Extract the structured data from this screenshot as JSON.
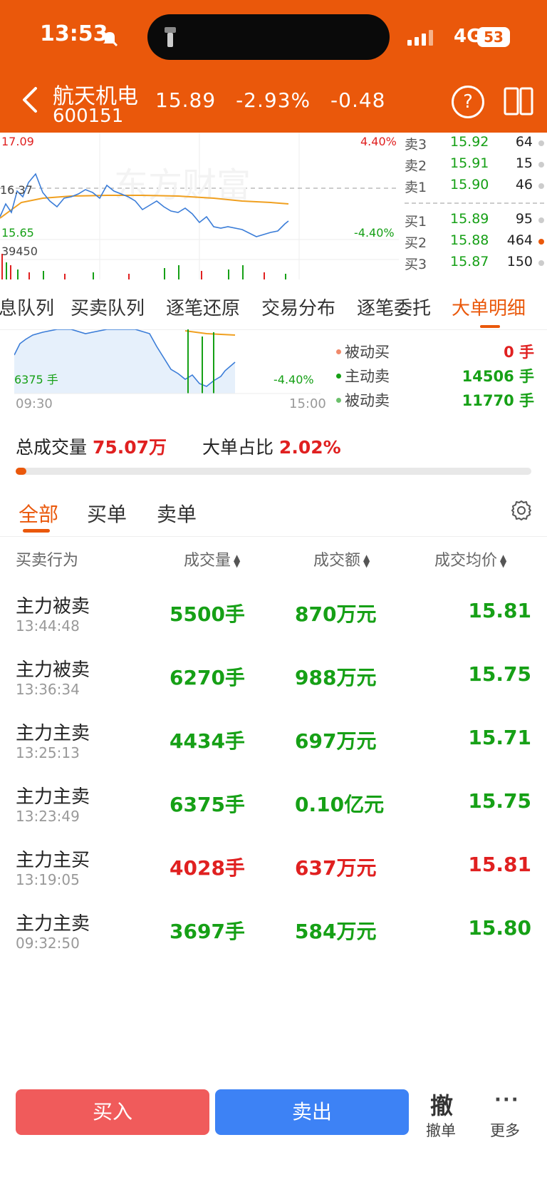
{
  "status_bar": {
    "time": "13:53",
    "network": "4G",
    "battery": "53"
  },
  "header": {
    "stock_name": "航天机电",
    "stock_code": "600151",
    "price": "15.89",
    "change_pct": "-2.93%",
    "change": "-0.48",
    "help": "?"
  },
  "mini_chart": {
    "high": "17.09",
    "high_pct": "4.40%",
    "pre_close": "16.37",
    "low": "15.65",
    "low_pct": "-4.40%",
    "vol": "39450",
    "watermark": "东方财富"
  },
  "order_book": {
    "asks": [
      {
        "label": "卖3",
        "price": "15.92",
        "vol": "64"
      },
      {
        "label": "卖2",
        "price": "15.91",
        "vol": "15"
      },
      {
        "label": "卖1",
        "price": "15.90",
        "vol": "46"
      }
    ],
    "bids": [
      {
        "label": "买1",
        "price": "15.89",
        "vol": "95"
      },
      {
        "label": "买2",
        "price": "15.88",
        "vol": "464"
      },
      {
        "label": "买3",
        "price": "15.87",
        "vol": "150"
      }
    ]
  },
  "tabs": [
    "息队列",
    "买卖队列",
    "逐笔还原",
    "交易分布",
    "逐笔委托",
    "大单明细"
  ],
  "big_chart": {
    "low_label": "6375 手",
    "low_pct": "-4.40%",
    "time_start": "09:30",
    "time_end": "15:00"
  },
  "legend": [
    {
      "label": "被动买",
      "value": "0 手",
      "dot": "#f08a6b",
      "color": "#e02020"
    },
    {
      "label": "主动卖",
      "value": "14506 手",
      "dot": "#16a016",
      "color": "#16a016"
    },
    {
      "label": "被动卖",
      "value": "11770 手",
      "dot": "#6cc06c",
      "color": "#16a016"
    }
  ],
  "summary": {
    "total_label": "总成交量",
    "total_value": "75.07万",
    "ratio_label": "大单占比",
    "ratio_value": "2.02%",
    "ratio_fraction": 0.0202
  },
  "filter_tabs": [
    "全部",
    "买单",
    "卖单"
  ],
  "table": {
    "headers": [
      "买卖行为",
      "成交量",
      "成交额",
      "成交均价"
    ],
    "rows": [
      {
        "action": "主力被卖",
        "time": "13:44:48",
        "volume": "5500手",
        "amount": "870万元",
        "avg": "15.81",
        "side": "sell"
      },
      {
        "action": "主力被卖",
        "time": "13:36:34",
        "volume": "6270手",
        "amount": "988万元",
        "avg": "15.75",
        "side": "sell"
      },
      {
        "action": "主力主卖",
        "time": "13:25:13",
        "volume": "4434手",
        "amount": "697万元",
        "avg": "15.71",
        "side": "sell"
      },
      {
        "action": "主力主卖",
        "time": "13:23:49",
        "volume": "6375手",
        "amount": "0.10亿元",
        "avg": "15.75",
        "side": "sell"
      },
      {
        "action": "主力主买",
        "time": "13:19:05",
        "volume": "4028手",
        "amount": "637万元",
        "avg": "15.81",
        "side": "buy"
      },
      {
        "action": "主力主卖",
        "time": "09:32:50",
        "volume": "3697手",
        "amount": "584万元",
        "avg": "15.80",
        "side": "sell"
      }
    ]
  },
  "bottom_bar": {
    "buy": "买入",
    "sell": "卖出",
    "cancel_icon": "撤",
    "cancel": "撤单",
    "more_icon": "···",
    "more": "更多"
  },
  "colors": {
    "accent": "#ea580b",
    "up": "#e02020",
    "down": "#16a016",
    "sell_button": "#3d82f5",
    "buy_button": "#f05b5b"
  }
}
